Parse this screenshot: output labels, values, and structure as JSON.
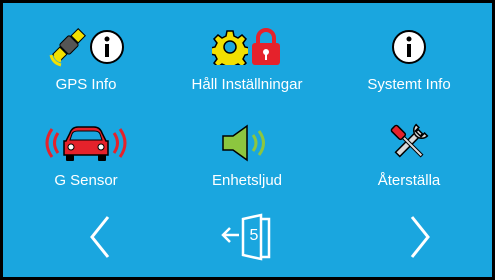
{
  "menu": {
    "items": [
      {
        "label": "GPS Info",
        "icons": [
          "satellite-icon",
          "info-icon"
        ]
      },
      {
        "label": "Håll Inställningar",
        "icons": [
          "gear-icon",
          "padlock-icon"
        ]
      },
      {
        "label": "Systemt Info",
        "icons": [
          "info-icon"
        ]
      },
      {
        "label": "G Sensor",
        "icons": [
          "car-vibration-icon"
        ]
      },
      {
        "label": "Enhetsljud",
        "icons": [
          "speaker-icon"
        ]
      },
      {
        "label": "Återställa",
        "icons": [
          "wrench-screwdriver-icon"
        ]
      }
    ]
  },
  "nav": {
    "exit_countdown": "5",
    "icons": [
      "chevron-left-icon",
      "exit-door-icon",
      "chevron-right-icon"
    ]
  },
  "colors": {
    "background": "#1aa6df",
    "gear": "#f2e000",
    "lock": "#e5222b",
    "car": "#e5222b",
    "speaker": "#8cc63f",
    "white": "#ffffff"
  }
}
